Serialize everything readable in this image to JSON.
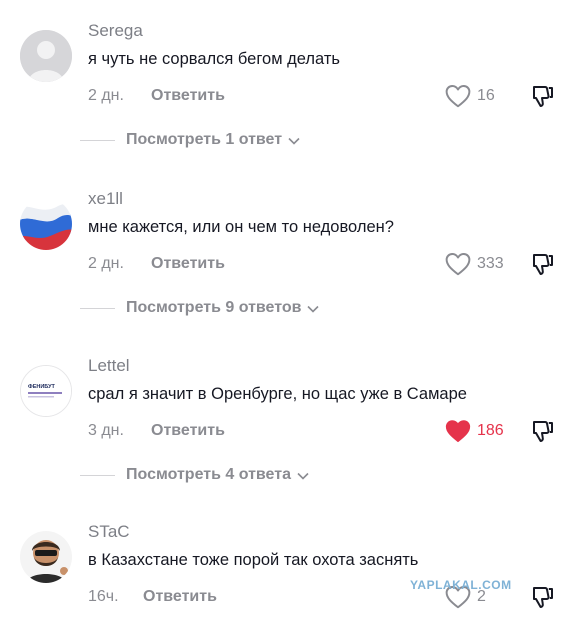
{
  "comments": [
    {
      "username": "Serega",
      "text": "я чуть не сорвался бегом делать",
      "time": "2 дн.",
      "reply_label": "Ответить",
      "likes": "16",
      "liked": false,
      "view_replies": "Посмотреть 1 ответ"
    },
    {
      "username": "xe1ll",
      "text": "мне кажется, или он чем то недоволен?",
      "time": "2 дн.",
      "reply_label": "Ответить",
      "likes": "333",
      "liked": false,
      "view_replies": "Посмотреть 9 ответов"
    },
    {
      "username": "Lettel",
      "text": "срал я значит в Оренбурге, но щас уже в Самаре",
      "time": "3 дн.",
      "reply_label": "Ответить",
      "likes": "186",
      "liked": true,
      "view_replies": "Посмотреть 4 ответа"
    },
    {
      "username": "STaC",
      "text": "в Казахстане тоже порой так охота заснять",
      "time": "16ч.",
      "reply_label": "Ответить",
      "likes": "2",
      "liked": false
    }
  ],
  "avatar_logo_text": "ФЕНИБУТ",
  "watermark": "YAPLAKAL.COM",
  "colors": {
    "text_primary": "#161823",
    "text_secondary": "#8a8b91",
    "liked_heart": "#e5334b",
    "watermark": "#7fb2d6"
  },
  "icons": [
    "heart-outline-icon",
    "heart-filled-icon",
    "dislike-icon",
    "chevron-down-icon"
  ]
}
